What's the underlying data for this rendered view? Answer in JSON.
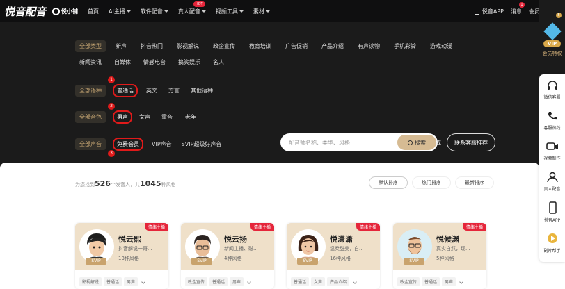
{
  "brand": {
    "name": "悦音配音",
    "sub": "悦小铺"
  },
  "nav": [
    {
      "label": "首页",
      "caret": false,
      "hot": ""
    },
    {
      "label": "AI主播",
      "caret": true,
      "hot": ""
    },
    {
      "label": "软件配音",
      "caret": true,
      "hot": ""
    },
    {
      "label": "真人配音",
      "caret": true,
      "hot": "HOT"
    },
    {
      "label": "视频工具",
      "caret": true,
      "hot": ""
    },
    {
      "label": "素材",
      "caret": true,
      "hot": ""
    }
  ],
  "header_right": {
    "app": "悦音APP",
    "messages": "消息",
    "message_count": "1",
    "member": "会员"
  },
  "filters": {
    "type_label": "全部类型",
    "types_row1": [
      "新声",
      "抖音热门",
      "影视解说",
      "政企宣传",
      "教育培训",
      "广告促销",
      "产品介绍",
      "有声读物",
      "手机彩铃",
      "游戏动漫"
    ],
    "types_row2": [
      "新闻资讯",
      "自媒体",
      "情感电台",
      "搞笑娱乐",
      "名人"
    ],
    "language_label": "全部语种",
    "languages": [
      "普通话",
      "英文",
      "方言",
      "其他语种"
    ],
    "voice_label": "全部音色",
    "voices": [
      "男声",
      "女声",
      "童音",
      "老年"
    ],
    "tier_label": "全部声音",
    "tiers": [
      "免费会员",
      "VIP声音",
      "SVIP超级好声音"
    ],
    "markers": [
      "1",
      "2",
      "3"
    ]
  },
  "search": {
    "placeholder": "配音师名称、类型、风格",
    "button": "搜索",
    "or": "或",
    "service_button": "联系客服推荐"
  },
  "results": {
    "prefix": "为您找到",
    "count": "526",
    "mid": "个发音人，共",
    "styles": "1045",
    "suffix": "种风格"
  },
  "sort": [
    "默认排序",
    "热门排序",
    "最新排序"
  ],
  "cards": [
    {
      "badge": "情绪主播",
      "name": "悦云熙",
      "desc": "抖音解说一哥...",
      "count": "13种风格",
      "level": "SVIP",
      "tags": [
        "影视解说",
        "普通话",
        "男声"
      ]
    },
    {
      "badge": "情绪主播",
      "name": "悦云扬",
      "desc": "新闻主播、磁...",
      "count": "4种风格",
      "level": "SVIP",
      "tags": [
        "政企宣传",
        "普通话",
        "男声"
      ]
    },
    {
      "badge": "情绪主播",
      "name": "悦潇潇",
      "desc": "温柔甜美，自...",
      "count": "16种风格",
      "level": "SVIP",
      "tags": [
        "普通话",
        "女声",
        "产品介绍"
      ]
    },
    {
      "badge": "情绪主播",
      "name": "悦候渊",
      "desc": "真实自然，现...",
      "count": "5种风格",
      "level": "SVIP",
      "tags": [
        "政企宣传",
        "普通话",
        "男声"
      ]
    }
  ],
  "sidebar": {
    "vip_badge": "VIP",
    "vip_number": "5",
    "vip_text": "会员特权",
    "items": [
      {
        "label": "微信客服",
        "icon": "headset-icon"
      },
      {
        "label": "客服热线",
        "icon": "phone-icon"
      },
      {
        "label": "视频制作",
        "icon": "video-icon"
      },
      {
        "label": "真人配音",
        "icon": "person-icon"
      },
      {
        "label": "悦音APP",
        "icon": "mobile-icon"
      },
      {
        "label": "副片帮手",
        "icon": "film-icon"
      }
    ]
  },
  "colors": {
    "accent": "#c9a874",
    "marker": "#e01a1a",
    "search_btn": "#d6bb93",
    "card_bg": "#efe0c9",
    "badge": "#e5253a"
  }
}
